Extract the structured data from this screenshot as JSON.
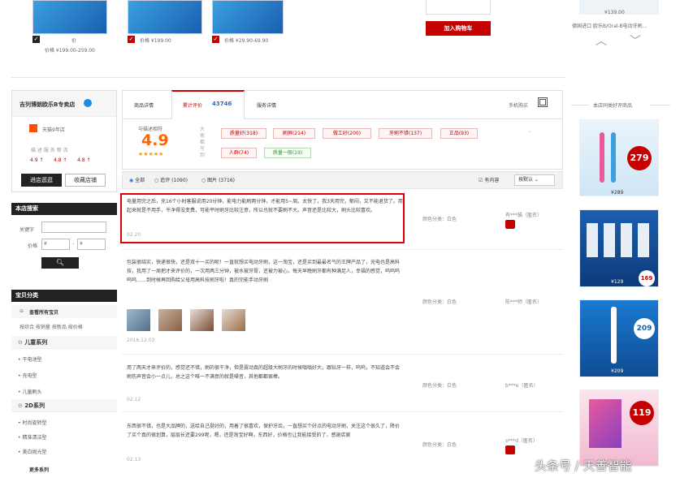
{
  "top": {
    "item1_price": "价格 ¥199.00-259.00",
    "item1_short": "价",
    "item2_price": "价格 ¥199.00",
    "item3_price": "价格 ¥29.90-69.90",
    "add_to_cart": "加入购物车",
    "right_price": "¥139.00",
    "right_title": "德国进口 欧乐B/Oral-B电动牙刷..."
  },
  "shop": {
    "name": "吉列博朗欧乐B专卖店",
    "years": "天猫9年店",
    "ratings_labels": "描 述   服 务   物 流",
    "ratings_values": [
      "4.9 ↑",
      "4.8 ↑",
      "4.8 ↑"
    ],
    "enter_btn": "进店逛逛",
    "fav_btn": "收藏店铺"
  },
  "search": {
    "title": "本店搜索",
    "keyword_label": "关键字",
    "price_label": "价格",
    "price_from_placeholder": "¥",
    "price_to_placeholder": "¥"
  },
  "categories": {
    "title": "宝贝分类",
    "all": "查看所有宝贝",
    "sort_links": "按综合 按销量 按新品 按价格",
    "groups": [
      {
        "name": "儿童系列",
        "items": [
          "干电池型",
          "充电型",
          "儿童刷头"
        ]
      },
      {
        "name": "2D系列",
        "items": [
          "时尚旋转型",
          "精准清洁型",
          "美白抛光型"
        ]
      }
    ],
    "more": "更多系列"
  },
  "tabs": {
    "details": "商品详情",
    "reviews_label": "累计评价",
    "reviews_count": "43746",
    "service": "服务详情",
    "mobile": "手机购买"
  },
  "summary": {
    "label": "与描述相符",
    "score": "4.9",
    "stars": "★★★★★",
    "side_label": "大家都写到",
    "tags": [
      {
        "text": "质量好(318)",
        "type": "red"
      },
      {
        "text": "刷屏(214)",
        "type": "red"
      },
      {
        "text": "做工好(200)",
        "type": "red"
      },
      {
        "text": "牙刷不错(137)",
        "type": "red"
      },
      {
        "text": "正品(93)",
        "type": "red"
      },
      {
        "text": "人群(74)",
        "type": "red"
      },
      {
        "text": "质量一般(19)",
        "type": "green"
      }
    ]
  },
  "filters": {
    "all": "全部",
    "append": "追评 (1090)",
    "pics": "图片 (3716)",
    "has_content": "有内容",
    "sort": "按默认"
  },
  "reviews": [
    {
      "text": "电量用完之后，充16个小时客服说用20分钟，能电力能刷两分钟，才能用5~周。太快了，我3天用完，郁闷，又不能退货了。用起来就是不用手，干净得没变费，可能平时刷牙比较注意，所以也就不要刷不大。声音还是比较大，刷头比较喜欢。",
      "date": "02.20",
      "color": "颜色分类：白色",
      "user": "有***猫（匿名）"
    },
    {
      "text": "包装很结实，快递很快，还是双十一买的呢！一直就想买电动牙刷，这一淘宝，还是买到最最名气的王牌产品了，充电也是高科技，我用了一周把才来评价的，一次用两三分钟，被水被牙膏，还被力被心，每天早晚刷牙都有种满足人，幸福的感觉，呜呜呜呜呜……到时候再回购给父母用高科技刷牙啦！真的完能手动牙刷",
      "date": "2016.12.03",
      "color": "颜色分类：白色",
      "user": "陈***师（匿名）"
    },
    {
      "text": "用了两天才来评价的，感觉还不错，刷的很干净，但是震动真的超级大刷牙的时候嗡嗡好大，跟钻牙一样，呜呜，不知道会不会刷伤声音会小一点儿，总之这个唯一不满意的就是噪音，其他都都很棒。",
      "date": "02.12",
      "color": "颜色分类：白色",
      "user": "b***e（匿名）"
    },
    {
      "text": "东西很不错，也是大品牌的，送给自己挺好的，用着了很喜欢，保护牙齿，一直想买个好点的电动牙刷，关注这个很久了，降价了买个真的很划算，层层长还要299呢，嗯，还是淘宝好啊，东西好，价格也让我能接受的了，感谢店家",
      "date": "02.13",
      "color": "颜色分类：白色",
      "user": "s***d（匿名）"
    }
  ],
  "recommend": {
    "title": "本店同类好评商品",
    "products": [
      {
        "badge": "279",
        "price": "¥289"
      },
      {
        "badge": "169",
        "price": "¥129"
      },
      {
        "badge": "209",
        "price": "¥209"
      },
      {
        "badge": "119",
        "price": ""
      }
    ]
  },
  "watermark": "头条号 / 天善智能",
  "colors": {
    "accent": "#c40000",
    "dark": "#222222",
    "highlight_border": "#e0000a"
  }
}
